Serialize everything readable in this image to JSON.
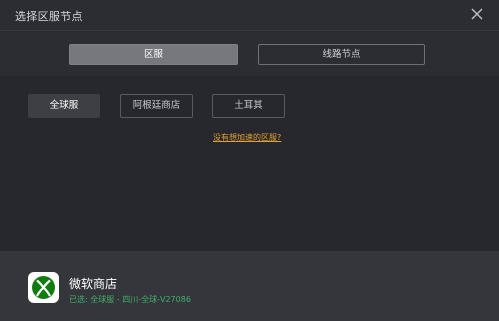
{
  "window": {
    "title": "选择区服节点",
    "close_icon": "close-icon"
  },
  "tabs": [
    {
      "label": "区服",
      "selected": true
    },
    {
      "label": "线路节点",
      "selected": false
    }
  ],
  "regions": [
    {
      "label": "全球服",
      "selected": true
    },
    {
      "label": "阿根廷商店",
      "selected": false
    },
    {
      "label": "土耳其",
      "selected": false
    }
  ],
  "help_link": "没有想加速的区服?",
  "footer": {
    "app_icon": "xbox-icon",
    "app_name": "微软商店",
    "status": "已选: 全球服 - 四川-全球-V27086"
  },
  "colors": {
    "background": "#27282d",
    "tab_active": "#77787d",
    "link": "#e0a12e",
    "status": "#3fae6a",
    "xbox_green": "#107c10"
  }
}
